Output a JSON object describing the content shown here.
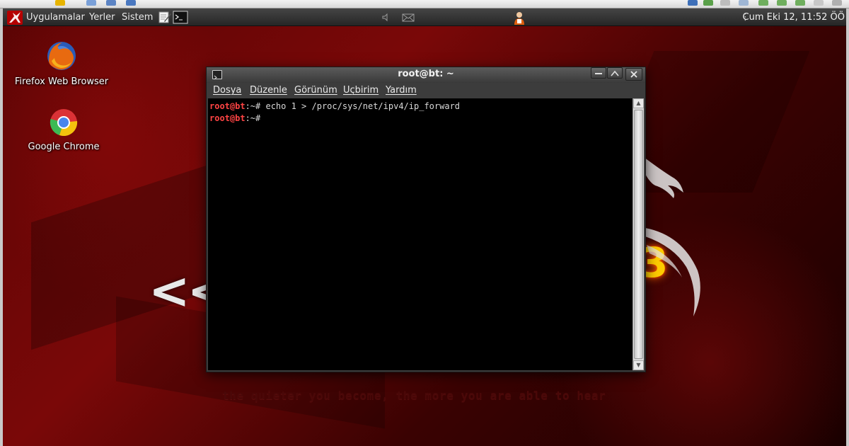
{
  "panel": {
    "menus": [
      "Uygulamalar",
      "Yerler",
      "Sistem"
    ],
    "clock": "Cum Eki 12, 11:52 ÖÖ"
  },
  "desktop_icons": [
    {
      "label": "Firefox Web Browser",
      "icon": "firefox-icon"
    },
    {
      "label": "Google Chrome",
      "icon": "chrome-icon"
    }
  ],
  "wallpaper": {
    "chevrons": "<<",
    "digit": "3",
    "tagline": "the quieter you become, the more you are able to hear"
  },
  "terminal": {
    "title": "root@bt: ~",
    "menu": [
      "Dosya",
      "Düzenle",
      "Görünüm",
      "Uçbirim",
      "Yardım"
    ],
    "lines": [
      {
        "user": "root@bt",
        "path": ":~# ",
        "command": "echo 1 > /proc/sys/net/ipv4/ip_forward"
      },
      {
        "user": "root@bt",
        "path": ":~# ",
        "command": ""
      }
    ]
  },
  "colors": {
    "prompt_user": "#ff4444",
    "terminal_bg": "#000000",
    "panel_bg": "#2e2e2e"
  }
}
